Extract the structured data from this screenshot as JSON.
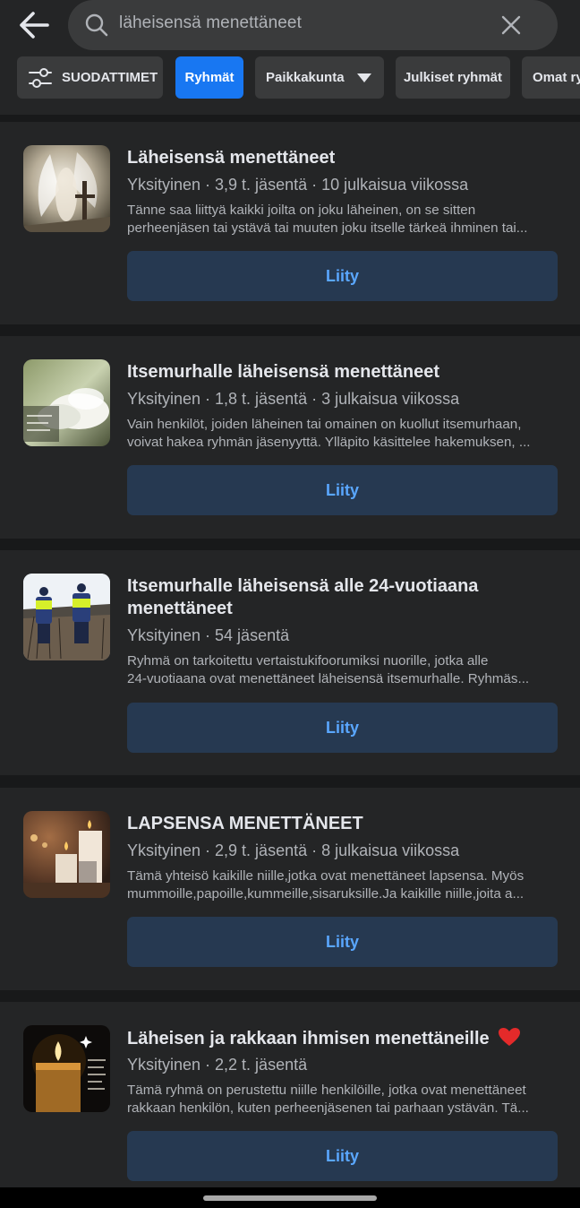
{
  "search": {
    "query": "läheisensä menettäneet"
  },
  "filters": {
    "filters_label": "SUODATTIMET",
    "groups_label": "Ryhmät",
    "location_label": "Paikkakunta",
    "public_groups_label": "Julkiset ryhmät",
    "own_groups_label": "Omat ry"
  },
  "groups": [
    {
      "title": "Läheisensä menettäneet",
      "meta": "Yksityinen · 3,9 t. jäsentä · 10 julkaisua viikossa",
      "desc_line1": "Tänne saa liittyä kaikki joilta on joku läheinen, on se sitten",
      "desc_line2": "perheenjäsen tai ystävä tai muuten joku itselle tärkeä ihminen tai...",
      "join_label": "Liity"
    },
    {
      "title": "Itsemurhalle läheisensä menettäneet",
      "meta": "Yksityinen · 1,8 t. jäsentä · 3 julkaisua viikossa",
      "desc_line1": "Vain henkilöt, joiden läheinen tai omainen on kuollut itsemurhaan,",
      "desc_line2": "voivat hakea ryhmän jäsenyyttä. Ylläpito käsittelee hakemuksen, ...",
      "join_label": "Liity"
    },
    {
      "title_line1": "Itsemurhalle läheisensä alle 24-vuotiaana",
      "title_line2": "menettäneet",
      "meta": "Yksityinen · 54 jäsentä",
      "desc_line1": "Ryhmä on tarkoitettu vertaistukifoorumiksi nuorille, jotka alle",
      "desc_line2": "24-vuotiaana ovat menettäneet läheisensä itsemurhalle. Ryhmäs...",
      "join_label": "Liity"
    },
    {
      "title": "LAPSENSA MENETTÄNEET",
      "meta": "Yksityinen · 2,9 t. jäsentä · 8 julkaisua viikossa",
      "desc_line1": "Tämä yhteisö kaikille niille,jotka ovat menettäneet lapsensa. Myös",
      "desc_line2": "mummoille,papoille,kummeille,sisaruksille.Ja kaikille niille,joita a...",
      "join_label": "Liity"
    },
    {
      "title": "Läheisen ja rakkaan ihmisen menettäneille",
      "meta": "Yksityinen · 2,2 t. jäsentä",
      "desc_line1": "Tämä ryhmä on perustettu niille henkilöille, jotka ovat menettäneet",
      "desc_line2": "rakkaan henkilön, kuten perheenjäsenen tai parhaan ystävän. Tä...",
      "join_label": "Liity"
    }
  ],
  "colors": {
    "background": "#18191a",
    "card": "#242526",
    "accent": "#1877f2",
    "join_button_bg": "#263951",
    "join_button_text": "#5aa7ff"
  },
  "icons": [
    "back-arrow-icon",
    "search-icon",
    "close-icon",
    "sliders-icon",
    "caret-down-icon",
    "heart-icon"
  ]
}
